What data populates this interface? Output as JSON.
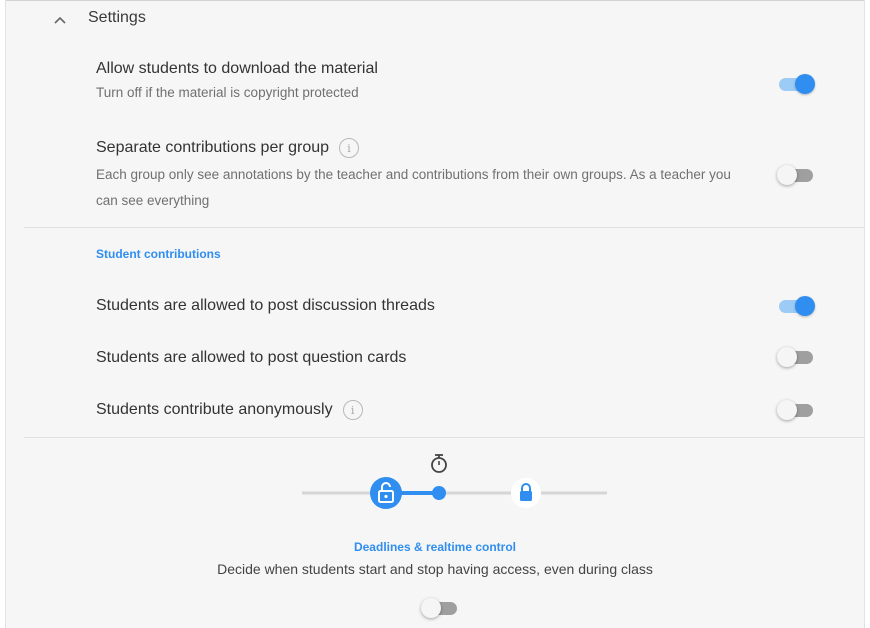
{
  "header": {
    "title": "Settings",
    "collapse_icon": "chevron-up-icon"
  },
  "settings": [
    {
      "title": "Allow students to download the material",
      "description": "Turn off if the material is copyright protected",
      "enabled": true
    },
    {
      "title": "Separate contributions per group",
      "description": "Each group only see annotations by the teacher and contributions from their own groups. As a teacher you can see everything",
      "has_info": true,
      "enabled": false
    }
  ],
  "student_contributions": {
    "label": "Student contributions",
    "items": [
      {
        "title": "Students are allowed to post discussion threads",
        "enabled": true
      },
      {
        "title": "Students are allowed to post question cards",
        "enabled": false
      },
      {
        "title": "Students contribute anonymously",
        "has_info": true,
        "enabled": false
      }
    ]
  },
  "deadlines": {
    "title": "Deadlines & realtime control",
    "description": "Decide when students start and stop having access, even during class",
    "enabled": false,
    "icons": {
      "start": "unlocked-padlock-icon",
      "timer": "stopwatch-icon",
      "end": "locked-padlock-icon"
    }
  },
  "info_glyph": "i",
  "colors": {
    "accent": "#2f8ef0",
    "panel_background": "#f6f6f6",
    "toggle_on_track": "#9ccbf5",
    "toggle_off_track": "#9f9f9f"
  }
}
